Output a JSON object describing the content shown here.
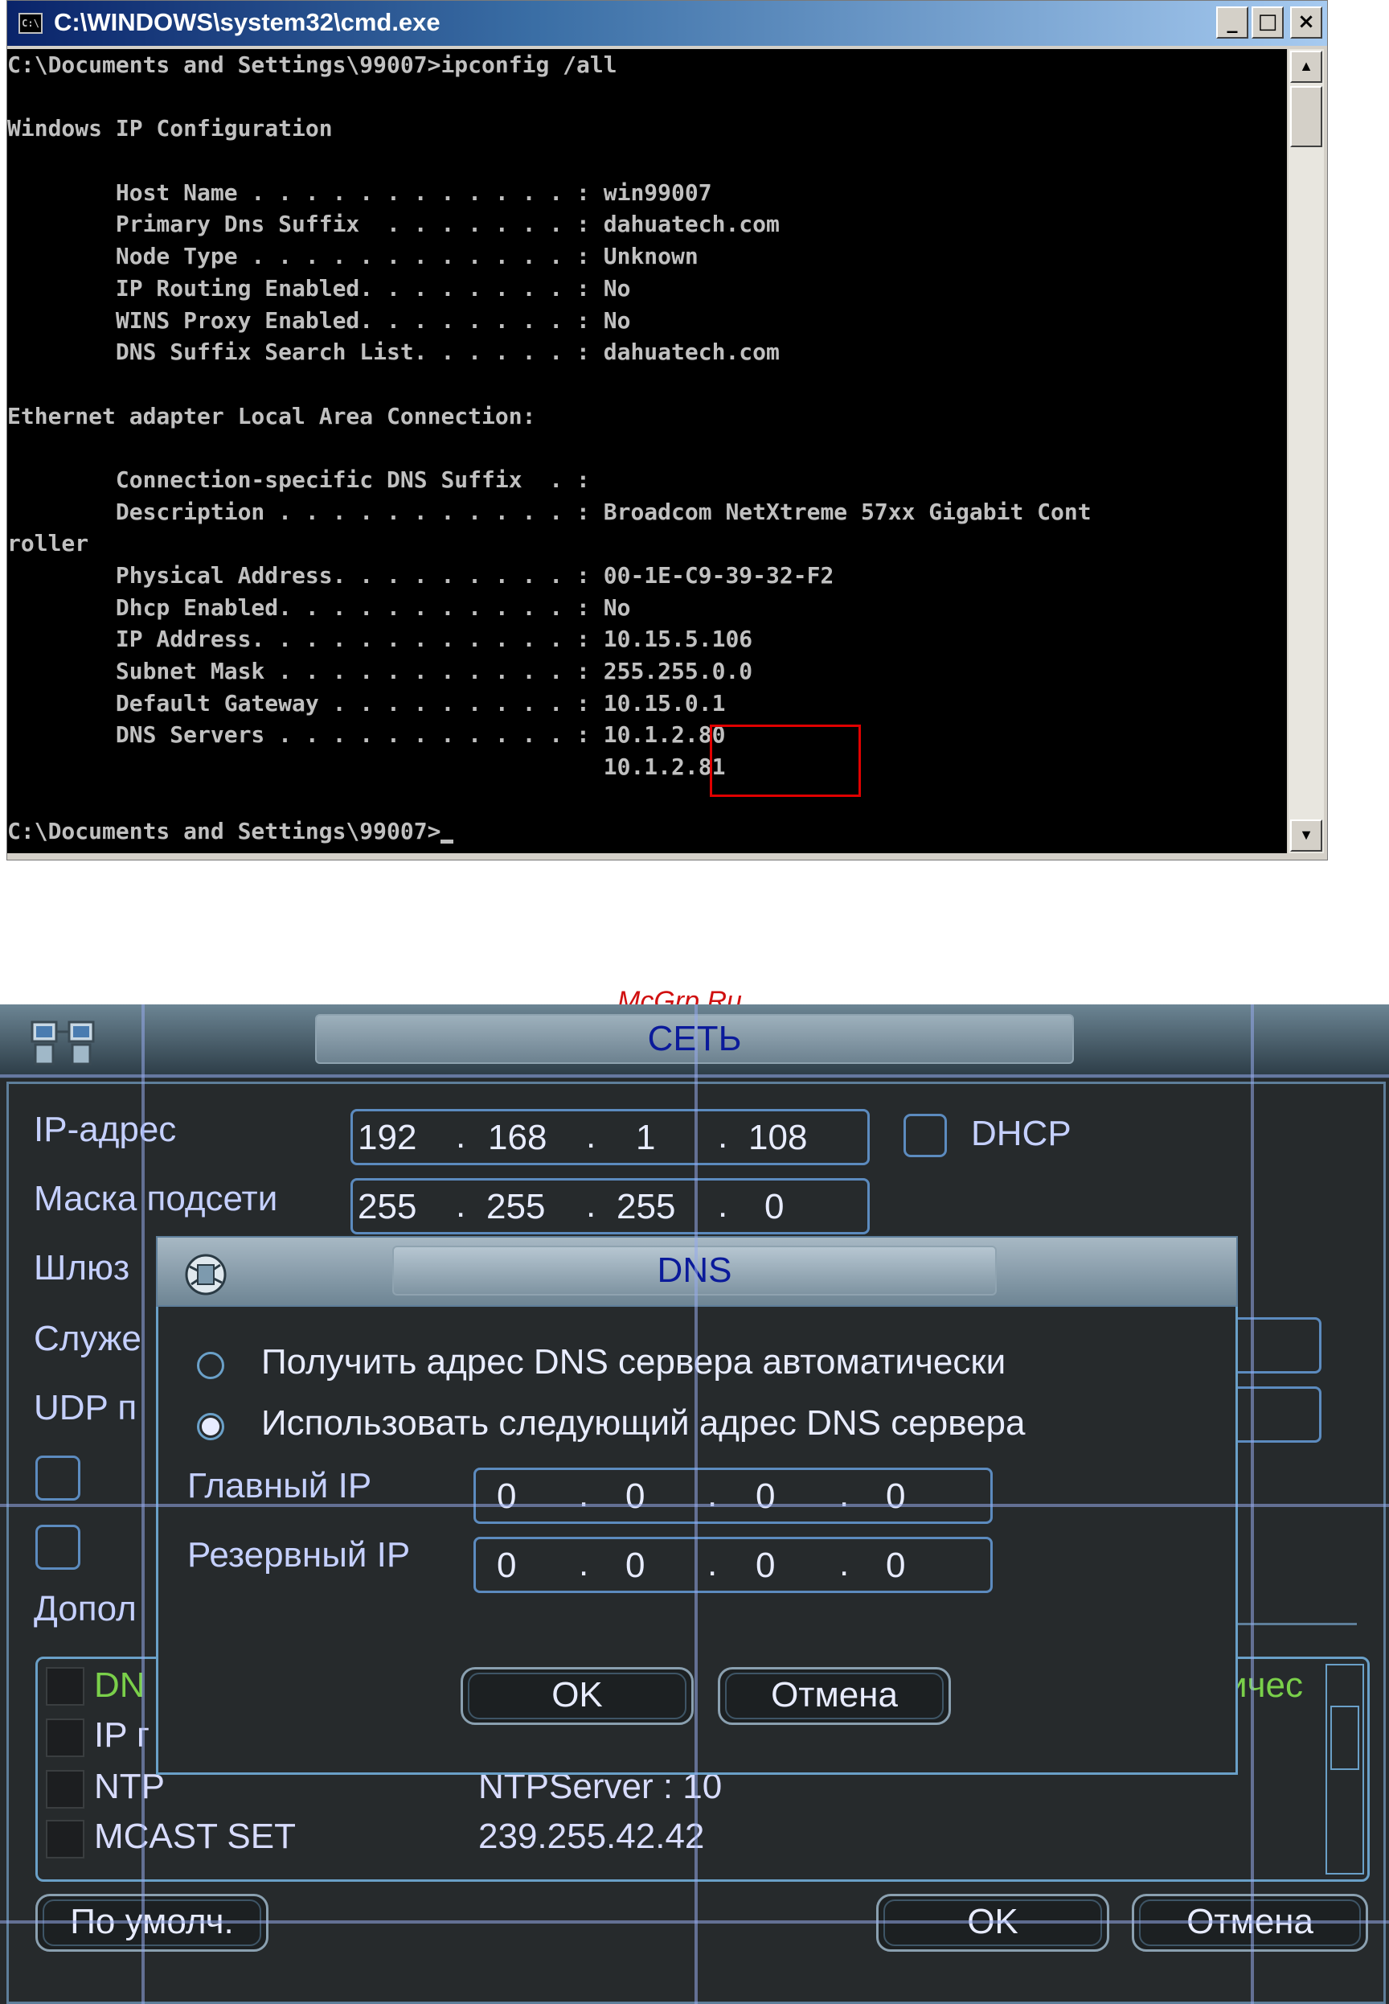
{
  "cmd": {
    "title": "C:\\WINDOWS\\system32\\cmd.exe",
    "window_buttons": {
      "minimize": "_",
      "maximize": "□",
      "close": "×"
    },
    "scroll_up": "▲",
    "scroll_down": "▼",
    "lines": [
      "C:\\Documents and Settings\\99007>ipconfig /all",
      "",
      "Windows IP Configuration",
      "",
      "        Host Name . . . . . . . . . . . . : win99007",
      "        Primary Dns Suffix  . . . . . . . : dahuatech.com",
      "        Node Type . . . . . . . . . . . . : Unknown",
      "        IP Routing Enabled. . . . . . . . : No",
      "        WINS Proxy Enabled. . . . . . . . : No",
      "        DNS Suffix Search List. . . . . . : dahuatech.com",
      "",
      "Ethernet adapter Local Area Connection:",
      "",
      "        Connection-specific DNS Suffix  . :",
      "        Description . . . . . . . . . . . : Broadcom NetXtreme 57xx Gigabit Cont",
      "roller",
      "        Physical Address. . . . . . . . . : 00-1E-C9-39-32-F2",
      "        Dhcp Enabled. . . . . . . . . . . : No",
      "        IP Address. . . . . . . . . . . . : 10.15.5.106",
      "        Subnet Mask . . . . . . . . . . . : 255.255.0.0",
      "        Default Gateway . . . . . . . . . : 10.15.0.1",
      "        DNS Servers . . . . . . . . . . . : 10.1.2.80",
      "                                            10.1.2.81",
      "",
      "C:\\Documents and Settings\\99007>"
    ]
  },
  "watermark": "McGrp.Ru",
  "dvr": {
    "title": "СЕТЬ",
    "ip_label": "IP-адрес",
    "ip": [
      "192",
      "168",
      "1",
      "108"
    ],
    "dhcp_label": "DHCP",
    "mask_label": "Маска подсети",
    "mask": [
      "255",
      "255",
      "255",
      "0"
    ],
    "gateway_label": "Шлюз",
    "service_label": "Служе",
    "udp_label": "UDP п",
    "advanced_label": "Допол",
    "list": [
      {
        "name": "DN",
        "value": "",
        "tail": "ичес"
      },
      {
        "name": "IP г",
        "value": ""
      },
      {
        "name": "NTP",
        "value": "NTPServer : 10"
      },
      {
        "name": "MCAST SET",
        "value": "239.255.42.42"
      }
    ],
    "default_button": "По умолч.",
    "ok_button": "OK",
    "cancel_button": "Отмена"
  },
  "dns_dialog": {
    "title": "DNS",
    "auto_option": "Получить адрес DNS сервера автоматически",
    "manual_option": "Использовать следующий адрес DNS сервера",
    "selected": "manual",
    "primary_label": "Главный IP",
    "primary_ip": [
      "0",
      "0",
      "0",
      "0"
    ],
    "secondary_label": "Резервный IP",
    "secondary_ip": [
      "0",
      "0",
      "0",
      "0"
    ],
    "ok_button": "OK",
    "cancel_button": "Отмена"
  },
  "colors": {
    "console_bg": "#000000",
    "console_text": "#c0c0c0",
    "highlight": "#e00000",
    "dvr_bg": "#262a2c",
    "dvr_label": "#c5d0ff",
    "list_active": "#7ad04a"
  }
}
